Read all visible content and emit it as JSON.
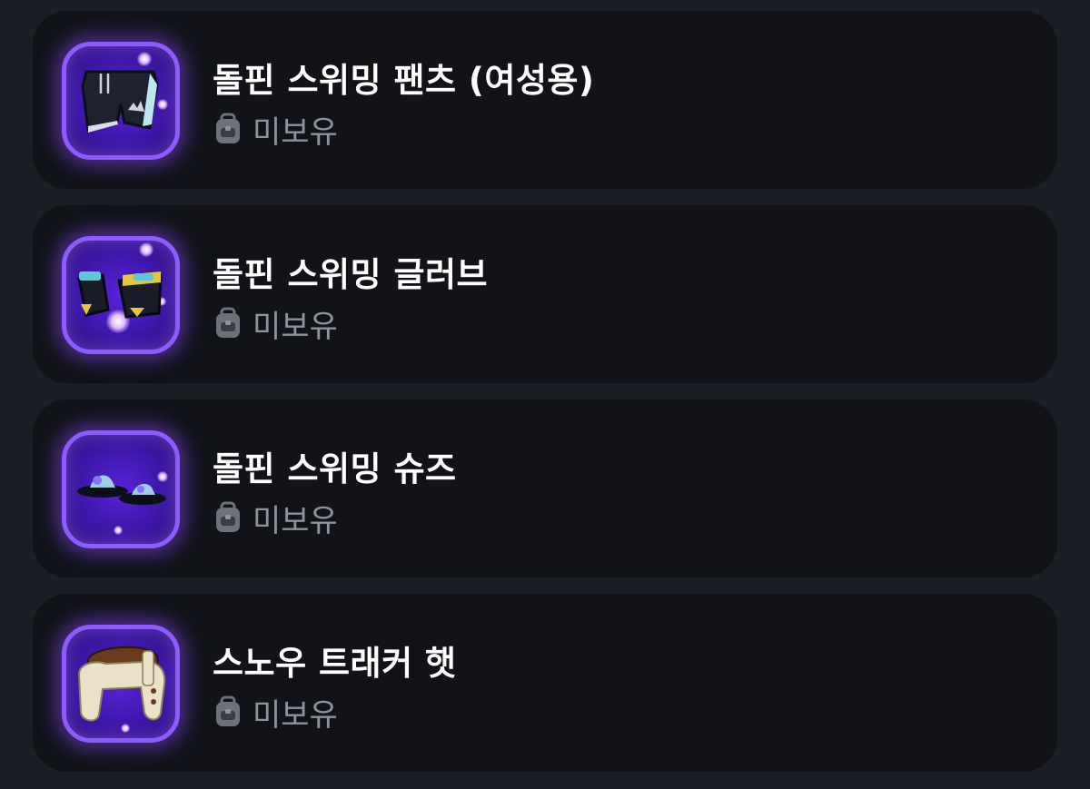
{
  "items": [
    {
      "name": "돌핀 스위밍 팬츠 (여성용)",
      "status": "미보유",
      "icon": "swim-pants-icon"
    },
    {
      "name": "돌핀 스위밍 글러브",
      "status": "미보유",
      "icon": "swim-gloves-icon"
    },
    {
      "name": "돌핀 스위밍 슈즈",
      "status": "미보유",
      "icon": "swim-shoes-icon"
    },
    {
      "name": "스노우 트래커 햇",
      "status": "미보유",
      "icon": "snow-hat-icon"
    }
  ],
  "status_icon": "backpack-icon",
  "colors": {
    "background": "#1b1e24",
    "card": "#111319",
    "thumb_border": "#8e5bff",
    "thumb_fill": "#3d17a8",
    "title": "#ffffff",
    "status": "#8f939c"
  }
}
